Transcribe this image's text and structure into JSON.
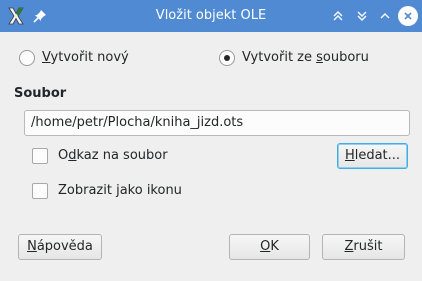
{
  "window": {
    "title": "Vložit objekt OLE",
    "app_icon": "kde-x-icon",
    "pin_icon": "pin-icon",
    "titlebar_color": "#4f8ad3",
    "close_icon_color": "#4f8ad3"
  },
  "mode": {
    "create_new": "Vytvořit nový",
    "create_from_file": "Vytvořit ze souboru",
    "selected": "create_from_file"
  },
  "file": {
    "label": "Soubor",
    "path_value": "/home/petr/Plocha/kniha_jizd.ots",
    "link_checkbox": "Odkaz na soubor",
    "link_checked": false,
    "search_button": "Hledat...",
    "display_icon_checkbox": "Zobrazit jako ikonu",
    "display_icon_checked": false
  },
  "buttons": {
    "help": "Nápověda",
    "ok": "OK",
    "cancel": "Zrušit"
  },
  "accent": "#3daee9"
}
